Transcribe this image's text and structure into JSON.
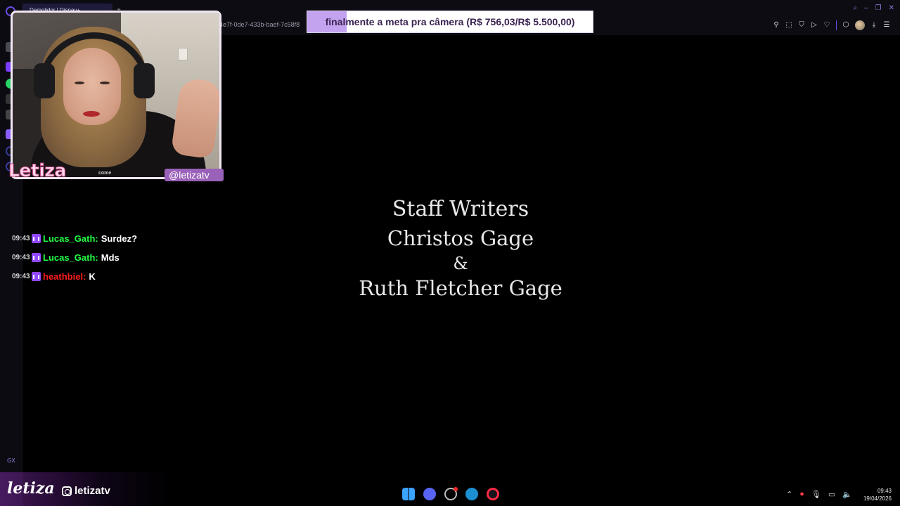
{
  "browser": {
    "tabs": [
      {
        "label": "Demolidor | Disney+"
      }
    ],
    "url_fragment": "4e7f-0de7-433b-baef-7c58f8",
    "window_controls": [
      "search",
      "minimize",
      "restore",
      "close"
    ],
    "toolbar_icons": [
      "pin-icon",
      "snapshot-icon",
      "shield-icon",
      "play-icon",
      "heart-icon",
      "extensions-icon",
      "avatar",
      "download-icon",
      "menu-icon"
    ],
    "sidebar_label": "GX"
  },
  "webcam": {
    "streamer_name": "Letiza",
    "handle": "@letizatv",
    "shirt_text": "come"
  },
  "goal": {
    "text": "finalmente a meta pra câmera (R$ 756,03/R$ 5.500,00)",
    "current": 756.03,
    "target": 5500.0,
    "progress_fraction": 0.1375,
    "fill_color": "#c3a3ef"
  },
  "chat": {
    "messages": [
      {
        "time": "09:43",
        "user": "Lucas_Gath",
        "separator": ":",
        "text": "Surdez?",
        "color": "#22ff44"
      },
      {
        "time": "09:43",
        "user": "Lucas_Gath",
        "separator": ":",
        "text": "Mds",
        "color": "#22ff44"
      },
      {
        "time": "09:43",
        "user": "heathbiel",
        "separator": ":",
        "text": "K",
        "color": "#ff1d1d"
      }
    ]
  },
  "credits": {
    "line1": "Staff Writers",
    "line2": "Christos Gage",
    "line3": "&",
    "line4": "Ruth Fletcher Gage"
  },
  "branding": {
    "logo": "letiza",
    "instagram": "letizatv"
  },
  "taskbar": {
    "apps": [
      "windows-start-icon",
      "discord-icon",
      "chrome-icon",
      "steam-icon",
      "opera-gx-icon"
    ],
    "tray_icons": [
      "chevron-up-icon",
      "opera-tray-icon",
      "microphone-icon",
      "display-icon",
      "speaker-icon"
    ],
    "time": "09:43",
    "date": "19/04/2026"
  }
}
